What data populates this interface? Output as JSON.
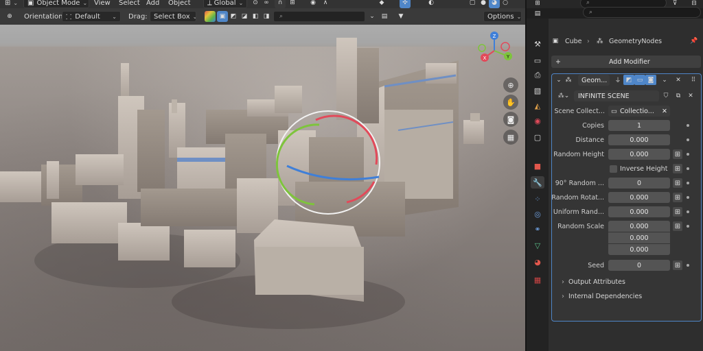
{
  "viewport": {
    "header": {
      "mode": "Object Mode",
      "menu": [
        "View",
        "Select",
        "Add",
        "Object"
      ],
      "transform_space": "Global"
    },
    "toolbar": {
      "orientation_label": "Orientation:",
      "orientation_value": "Default",
      "drag_label": "Drag:",
      "drag_value": "Select Box",
      "options_label": "Options"
    },
    "gizmo": {
      "x": "X",
      "y": "Y",
      "z": "Z"
    },
    "colors": {
      "x_axis": "#e24a5a",
      "y_axis": "#7ec43c",
      "z_axis": "#3f7fd8",
      "accent": "#4f86c8"
    }
  },
  "properties": {
    "breadcrumb": {
      "object": "Cube",
      "modifier": "GeometryNodes"
    },
    "add_modifier": "Add Modifier",
    "modifier": {
      "name": "Geom...",
      "node_group": "INFINITE SCENE",
      "fields": [
        {
          "label": "Scene Collect...",
          "value": "Collectio..."
        },
        {
          "label": "Copies",
          "value": "1"
        },
        {
          "label": "Distance",
          "value": "0.000"
        },
        {
          "label": "Random Height",
          "value": "0.000"
        },
        {
          "label": "Inverse Height",
          "value": ""
        },
        {
          "label": "90° Random ...",
          "value": "0"
        },
        {
          "label": "Random Rotat...",
          "value": "0.000"
        },
        {
          "label": "Uniform Rand...",
          "value": "0.000"
        },
        {
          "label": "Random Scale",
          "value": "0.000"
        },
        {
          "label": "",
          "value": "0.000"
        },
        {
          "label": "",
          "value": "0.000"
        },
        {
          "label": "Seed",
          "value": "0"
        }
      ],
      "panels": [
        "Output Attributes",
        "Internal Dependencies"
      ]
    }
  }
}
